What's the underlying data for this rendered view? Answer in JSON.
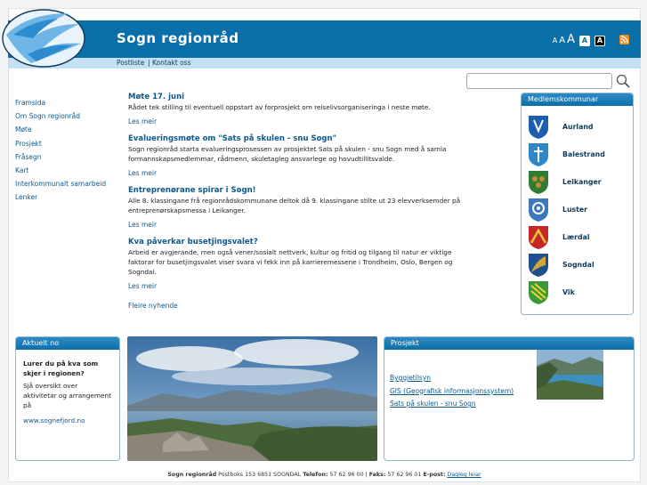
{
  "header": {
    "title": "Sogn regionråd"
  },
  "text_size": {
    "small": "A",
    "medium": "A",
    "large": "A",
    "contrast_normal": "A",
    "contrast_high": "A"
  },
  "subnav": {
    "items": [
      "Postliste",
      "Kontakt oss"
    ]
  },
  "search": {
    "placeholder": ""
  },
  "left_nav": {
    "items": [
      "Framsida",
      "Om Sogn regionråd",
      "Møte",
      "Prosjekt",
      "Fråsegn",
      "Kart",
      "Interkommunalt samarbeid",
      "Lenker"
    ]
  },
  "news": {
    "items": [
      {
        "title": "Møte 17. juni",
        "body": "Rådet tek stilling til eventuell oppstart av forprosjekt om reiselivsorganiseringa i neste møte.",
        "more": "Les meir"
      },
      {
        "title": "Evalueringsmøte om \"Sats på skulen - snu Sogn\"",
        "body": "Sogn regionråd starta evalueringsprosessen av prosjektet Sats på skulen - snu Sogn med å samla formannskapsmedlemmar, rådmenn, skuletagleg ansvarlege og hovudtillitsvalde.",
        "more": "Les meir"
      },
      {
        "title": "Entreprenørane spirar i Sogn!",
        "body": "Alle 8. klassingane frå regionrådskommunane deltok då 9. klassingane stilte ut 23 elevverksemder på entreprenørskapsmessa i Leikanger.",
        "more": "Les meir"
      },
      {
        "title": "Kva påverkar busetjingsvalet?",
        "body": "Arbeid er avgjerande, men også vener/sosialt nettverk, kultur og fritid og tilgang til natur er viktige faktorar for busetjingsvalet viser svara vi fekk inn på karrieremessene i Trondheim, Oslo, Bergen og Sogndal.",
        "more": "Les meir"
      }
    ],
    "more_news": "Fleire nyhende"
  },
  "members": {
    "heading": "Medlemskommunar",
    "items": [
      {
        "name": "Aurland",
        "color": "#1c5fb0"
      },
      {
        "name": "Balestrand",
        "color": "#2f86c8"
      },
      {
        "name": "Leikanger",
        "color": "#2e7d32"
      },
      {
        "name": "Luster",
        "color": "#3b78c0"
      },
      {
        "name": "Lærdal",
        "color": "#c62828"
      },
      {
        "name": "Sogndal",
        "color": "#1e4f8f"
      },
      {
        "name": "Vik",
        "color": "#3a9a3a"
      }
    ]
  },
  "aktuelt": {
    "heading": "Aktuelt no",
    "lead": "Lurer du på kva som skjer i regionen?",
    "body": "Sjå oversikt over aktivitetar og arrangement på",
    "link": "www.sognefjord.no"
  },
  "prosjekt": {
    "heading": "Prosjekt",
    "links": [
      "Byggjetilsyn",
      "GIS (Geografisk informasjonssystem)",
      "Sats på skulen - snu Sogn"
    ]
  },
  "footer": {
    "org": "Sogn regionråd",
    "address": "Postboks 153 6851 SOGNDAL",
    "phone_label": "Telefon:",
    "phone": "57 62 96 00",
    "fax_label": "Faks:",
    "fax": "57 62 96 01",
    "email_label": "E-post:",
    "email": "Dagleg leiar"
  },
  "colors": {
    "header": "#0b6fa9",
    "subnav": "#c4e1f4",
    "link": "#0b5a8e"
  }
}
